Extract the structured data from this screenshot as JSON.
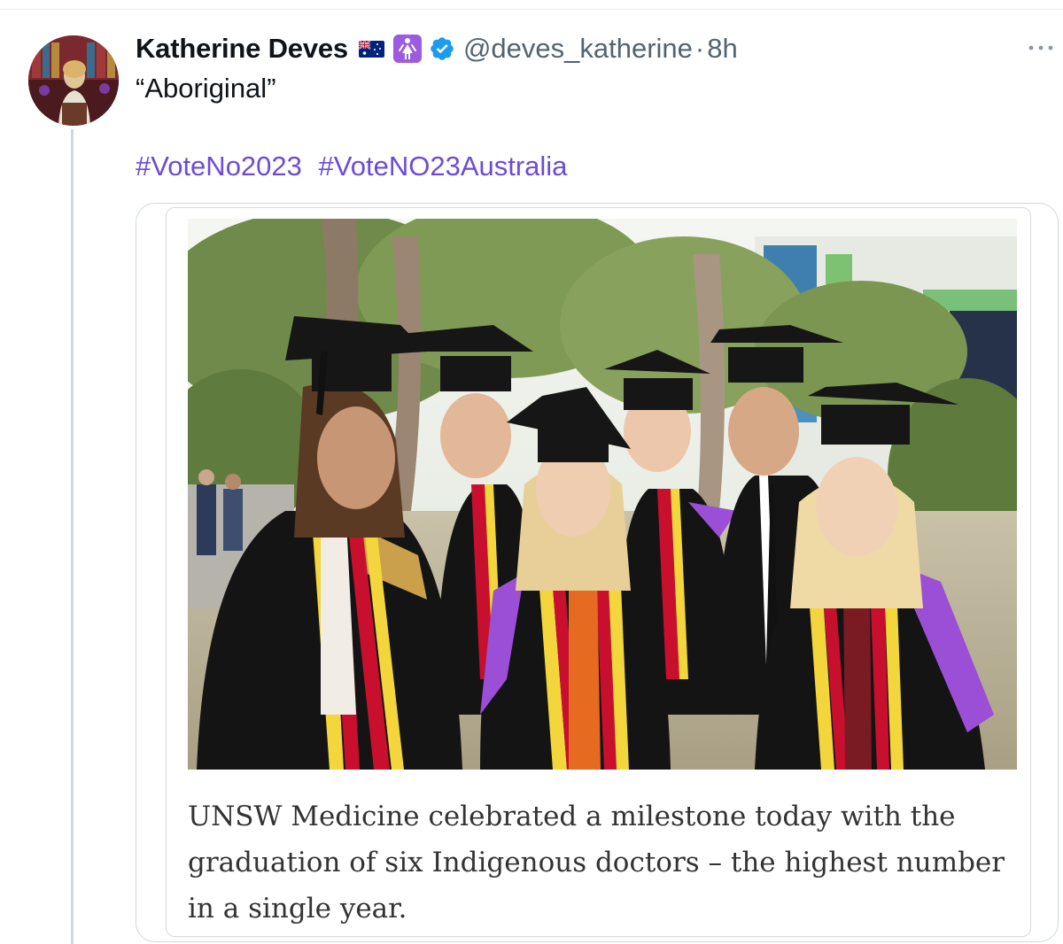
{
  "tweet": {
    "display_name": "Katherine Deves",
    "badges": [
      "australia-flag-icon",
      "female-sign-icon",
      "verified-badge-icon"
    ],
    "handle": "@deves_katherine",
    "separator": "·",
    "time": "8h",
    "text": "“Aboriginal”",
    "hashtags": [
      "#VoteNo2023",
      "#VoteNO23Australia"
    ]
  },
  "media": {
    "caption": "UNSW Medicine celebrated a milestone today with the graduation of six Indigenous doctors – the highest number in a single year."
  },
  "colors": {
    "hashtag": "#6e4bd6",
    "verified": "#1d9bf0",
    "secondary_text": "#536471",
    "gown_black": "#141414",
    "stole_red": "#c8102e",
    "stole_yellow": "#f2d63b",
    "hood_purple": "#9b4fd6"
  }
}
